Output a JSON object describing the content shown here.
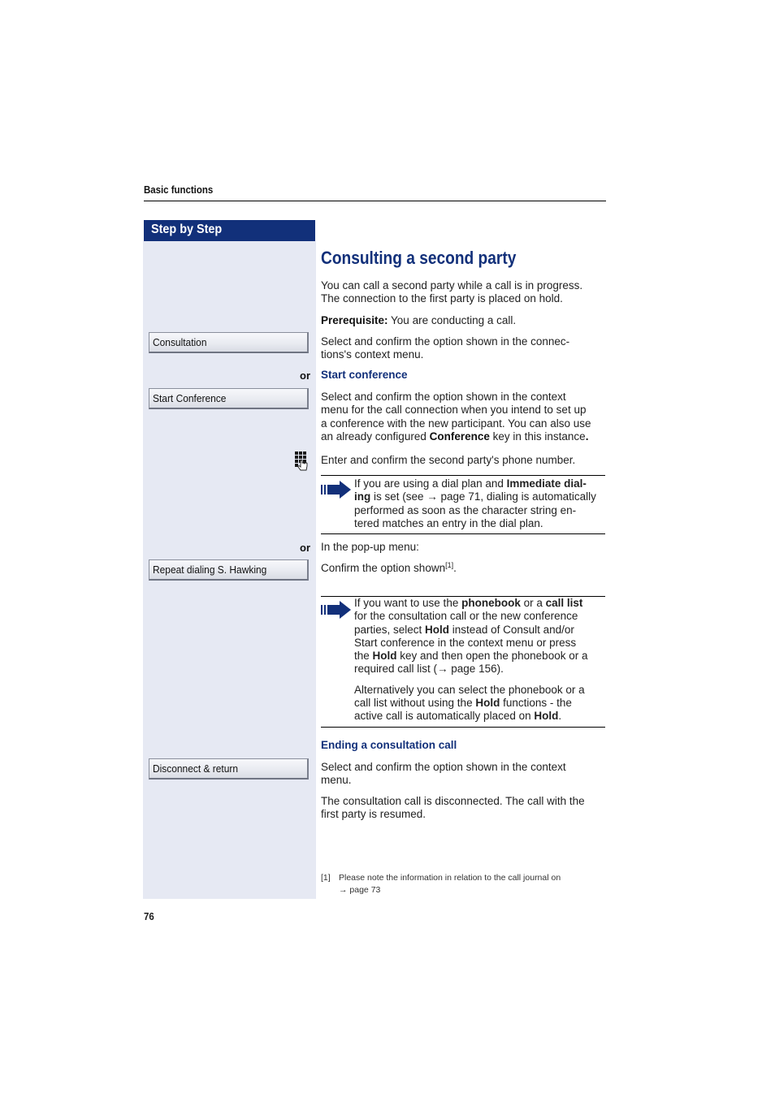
{
  "header": {
    "section": "Basic functions"
  },
  "sidebar": {
    "title": "Step by Step",
    "softkeys": [
      {
        "label": "Consultation"
      },
      {
        "label": "Start Conference"
      },
      {
        "label": "Repeat dialing S. Hawking"
      },
      {
        "label": "Disconnect & return"
      }
    ],
    "or_labels": [
      "or",
      "or"
    ],
    "icons": {
      "keypad": "keypad-finger-icon",
      "note": "note-arrow-icon"
    }
  },
  "main": {
    "title": "Consulting a second party",
    "intro_line1": "You can call a second party while a call is in progress.",
    "intro_line2": "The connection to the first party is placed on hold.",
    "prerequisite_label": "Prerequisite:",
    "prerequisite_text": " You are conducting a call.",
    "consultation_line1": "Select and confirm the option shown in the connec-",
    "consultation_line2": "tions's context menu.",
    "start_conference_heading": "Start conference",
    "conference_line1": "Select and confirm the option shown in the context",
    "conference_line2": "menu for the call connection when you intend to set up",
    "conference_line3": "a conference with the new participant. You can also use",
    "conference_line4_pre": "an already configured ",
    "conference_line4_bold": "Conference",
    "conference_line4_post": " key in this instance",
    "conference_line4_end": ".",
    "enter_number": "Enter and confirm the second party's phone number.",
    "note1": {
      "l1_pre": "If you are using a dial plan and ",
      "l1_bold": "Immediate dial-",
      "l2_bold": "ing",
      "l2_post": " is set (see → page 71, dialing is automatically",
      "l3": "performed as soon as the character string en-",
      "l4": "tered matches an entry in the dial plan."
    },
    "popup_menu": "In the pop-up menu:",
    "confirm_option": "Confirm the option shown",
    "footnote_ref": "[1]",
    "confirm_option_end": ".",
    "note2": {
      "l1_pre": "If you want to use the ",
      "l1_b1": "phonebook",
      "l1_mid": " or a ",
      "l1_b2": "call list",
      "l2": "for the consultation call or the new conference",
      "l3_pre": "parties, select ",
      "l3_bold": "Hold",
      "l3_post": " instead of Consult and/or",
      "l4": "Start conference in the context menu or press",
      "l5_pre": "the ",
      "l5_bold": "Hold",
      "l5_post": " key and then open the phonebook or a",
      "l6": "required call list (→ page 156).",
      "alt_l1": "Alternatively you can select the phonebook or a",
      "alt_l2_pre": "call list without using the ",
      "alt_l2_bold": "Hold",
      "alt_l2_post": " functions - the",
      "alt_l3_pre": "active call is automatically placed on ",
      "alt_l3_bold": "Hold",
      "alt_l3_post": "."
    },
    "ending_heading": "Ending a consultation call",
    "ending_line1": "Select and confirm the option shown in the context",
    "ending_line2": "menu.",
    "result_line1": "The consultation call is disconnected. The call with the",
    "result_line2": "first party is resumed."
  },
  "footnote": {
    "number": "[1]",
    "text": "Please note the information in relation to the call journal on",
    "ref": "→ page 73"
  },
  "page_number": "76",
  "colors": {
    "brand_blue": "#12307a",
    "sidebar_bg": "#e6e9f3"
  }
}
